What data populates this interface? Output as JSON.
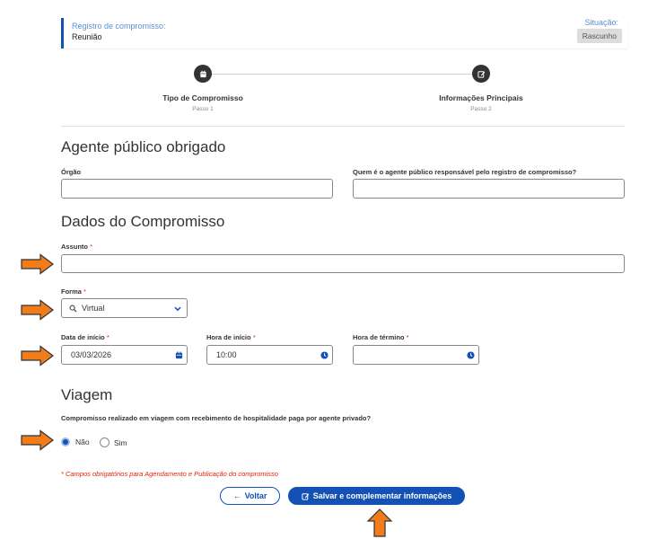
{
  "header": {
    "registro_label": "Registro de compromisso:",
    "registro_value": "Reunião",
    "situacao_label": "Situação:",
    "situacao_badge": "Rascunho"
  },
  "steps": [
    {
      "title": "Tipo de Compromisso",
      "sub": "Passo 1",
      "icon": "calendar-icon"
    },
    {
      "title": "Informações Principais",
      "sub": "Passo 2",
      "icon": "edit-icon"
    }
  ],
  "agente": {
    "title": "Agente público obrigado",
    "orgao_label": "Órgão",
    "orgao_value": "",
    "responsavel_label": "Quem é o agente público responsável pelo registro de compromisso?",
    "responsavel_value": ""
  },
  "dados": {
    "title": "Dados do Compromisso",
    "assunto_label": "Assunto",
    "assunto_value": "",
    "forma_label": "Forma",
    "forma_value": "Virtual",
    "data_inicio_label": "Data de início",
    "data_inicio_value": "03/03/2026",
    "hora_inicio_label": "Hora de início",
    "hora_inicio_value": "10:00",
    "hora_termino_label": "Hora de término",
    "hora_termino_value": ""
  },
  "viagem": {
    "title": "Viagem",
    "question": "Compromisso realizado em viagem com recebimento de hospitalidade paga por agente privado?",
    "option_nao": "Não",
    "option_sim": "Sim",
    "selected": "Não"
  },
  "required_mark": "*",
  "note": "* Campos obrigatórios para Agendamento e Publicação do compromisso",
  "buttons": {
    "voltar": "Voltar",
    "salvar": "Salvar e complementar informações"
  },
  "colors": {
    "primary": "#1351b4",
    "required": "#e52207",
    "arrow": "#f07c1a"
  }
}
